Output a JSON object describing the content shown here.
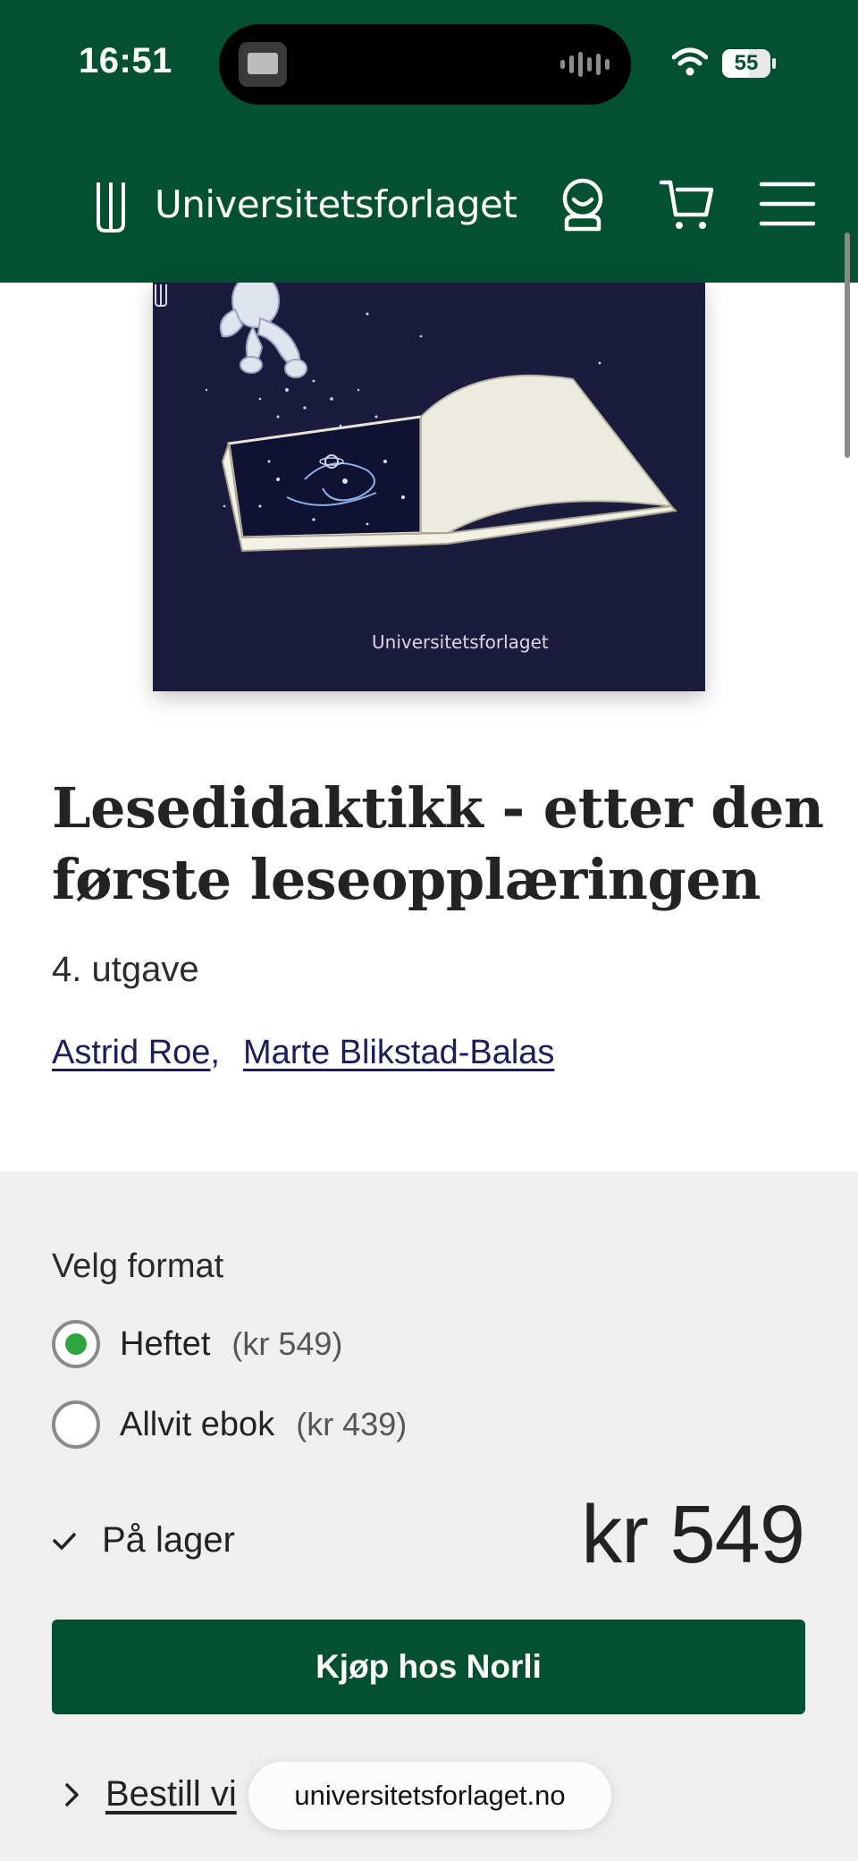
{
  "status_bar": {
    "time": "16:51",
    "battery": "55",
    "battery_level": 0.55,
    "icons": [
      "wifi-icon",
      "battery-icon"
    ]
  },
  "header": {
    "brand": "Universitetsforlaget",
    "icons": [
      "account-icon",
      "cart-icon",
      "menu-icon"
    ],
    "background": "#035132"
  },
  "cover": {
    "publisher": "Universitetsforlaget"
  },
  "book": {
    "title": "Lesedidaktikk - etter den første leseopplæringen",
    "edition": "4. utgave",
    "authors": [
      {
        "name": "Astrid Roe",
        "separator": ","
      },
      {
        "name": "Marte Blikstad-Balas"
      }
    ]
  },
  "purchase": {
    "format_label": "Velg format",
    "options": [
      {
        "name": "Heftet",
        "price": "(kr 549)",
        "selected": true
      },
      {
        "name": "Allvit ebok",
        "price": "(kr 439)",
        "selected": false
      }
    ],
    "stock": "På lager",
    "price": "kr 549",
    "buy_button": "Kjøp hos Norli",
    "more_link": "Bestill vi",
    "accent_green": "#2ea43c"
  },
  "browser": {
    "url": "universitetsforlaget.no"
  }
}
